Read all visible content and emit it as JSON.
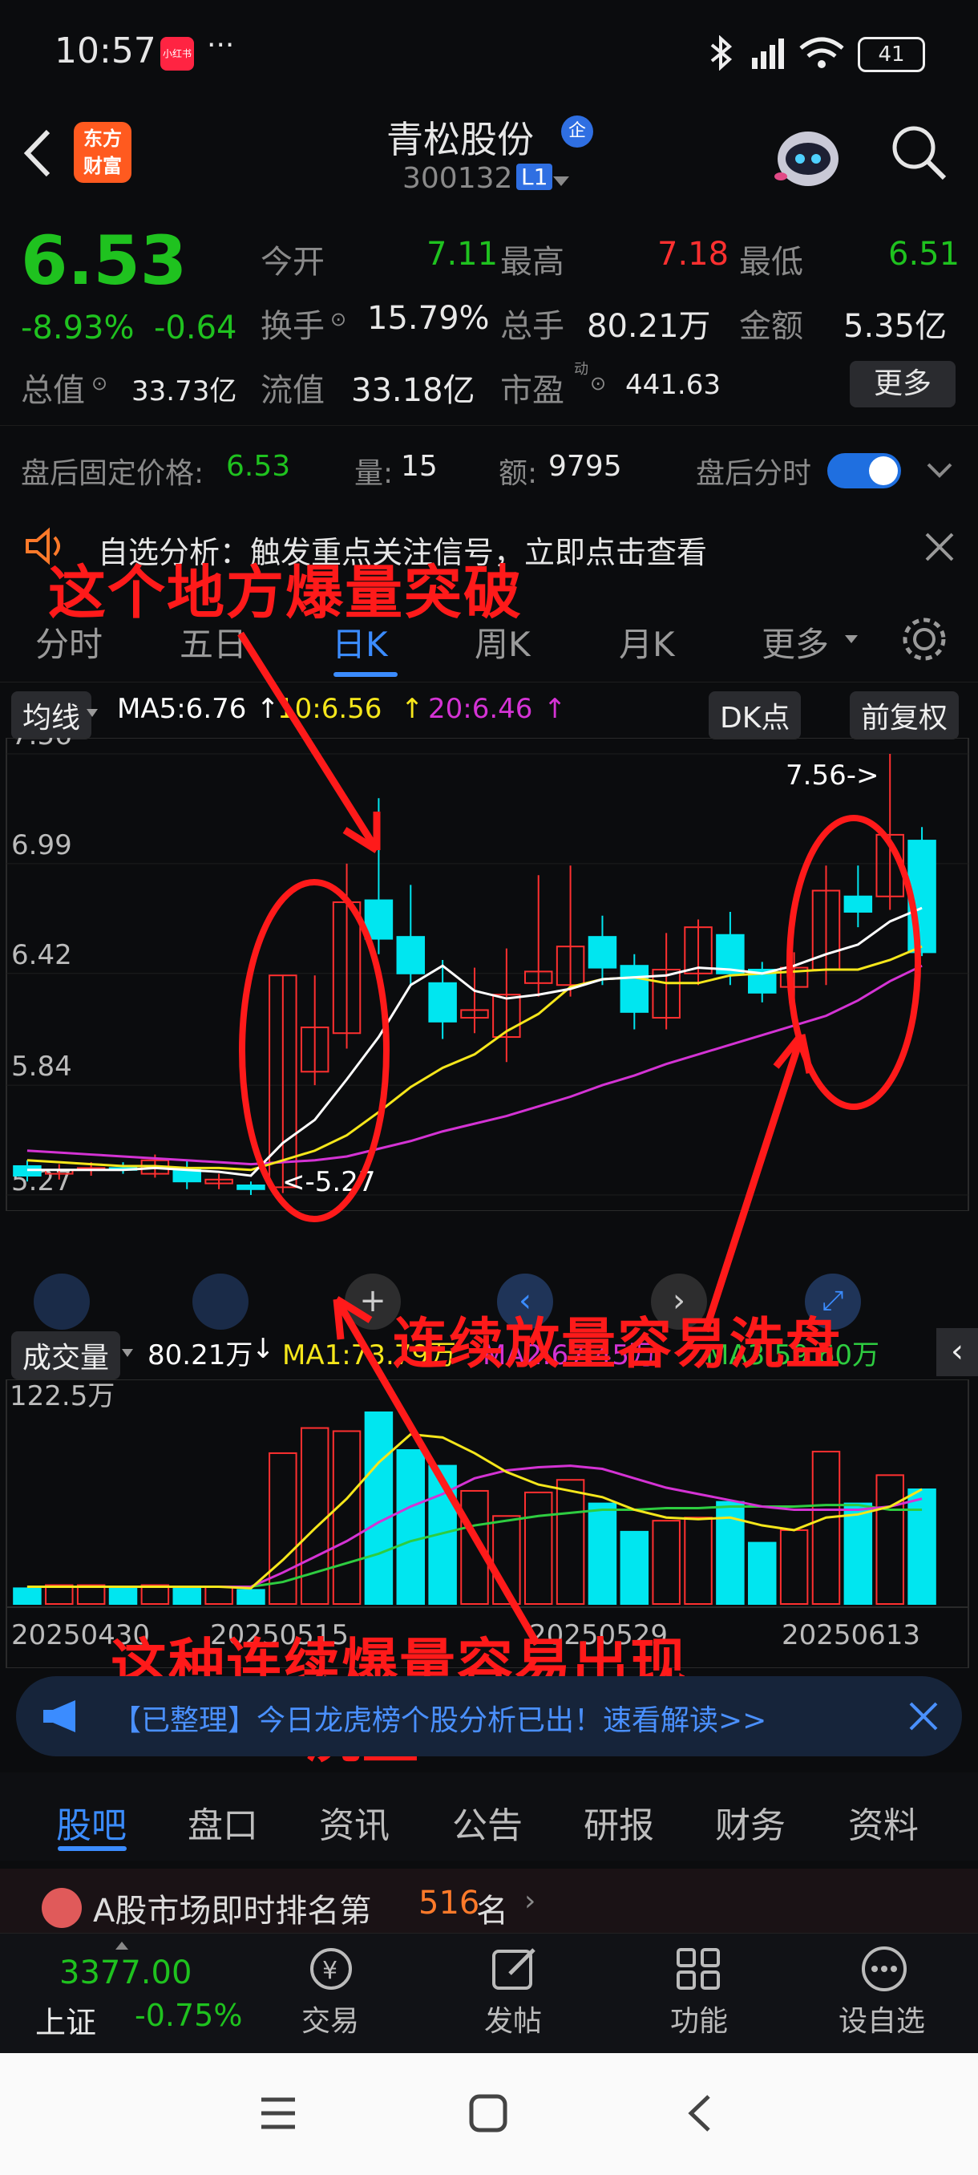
{
  "status": {
    "time": "10:57",
    "app_badge": "小红书",
    "dots": "···",
    "battery": "41"
  },
  "header": {
    "logo_line1": "东方",
    "logo_line2": "财富",
    "title": "青松股份",
    "title_badge": "企",
    "code": "300132",
    "level": "L1"
  },
  "quote": {
    "price": "6.53",
    "change_pct": "-8.93%",
    "change": "-0.64",
    "open_label": "今开",
    "open": "7.11",
    "high_label": "最高",
    "high": "7.18",
    "low_label": "最低",
    "low": "6.51",
    "turnover_label": "换手",
    "turnover": "15.79%",
    "volume_label": "总手",
    "volume": "80.21万",
    "amount_label": "金额",
    "amount": "5.35亿",
    "mktcap_label": "总值",
    "mktcap": "33.73亿",
    "float_label": "流值",
    "float": "33.18亿",
    "pe_label": "市盈",
    "pe_sup": "动",
    "pe": "441.63",
    "more": "更多"
  },
  "after_hours": {
    "price_label": "盘后固定价格:",
    "price": "6.53",
    "qty_label": "量:",
    "qty": "15",
    "amt_label": "额:",
    "amt": "9795",
    "intraday_label": "盘后分时",
    "toggle_on": true
  },
  "notice": {
    "text": "自选分析：触发重点关注信号，立即点击查看"
  },
  "chart_tabs": [
    {
      "label": "分时"
    },
    {
      "label": "五日"
    },
    {
      "label": "日K"
    },
    {
      "label": "周K"
    },
    {
      "label": "月K"
    },
    {
      "label": "更多"
    }
  ],
  "ma_bar": {
    "selector": "均线",
    "ma5": "MA5:6.76",
    "ma10": "10:6.56",
    "ma20": "20:6.46",
    "dk": "DK点",
    "adjust": "前复权"
  },
  "vol_bar": {
    "selector": "成交量",
    "vol": "80.21万",
    "ma1": "MA1:73.79万",
    "ma2": "MA2:67.45万",
    "ma3": "MA3:59.60万"
  },
  "annotations": {
    "a1": "这个地方爆量突破",
    "a2": "连续放量容易洗盘",
    "a3_line1": "这种连续爆量容易出现",
    "a3_line2": "洗盘"
  },
  "chart_data": {
    "type": "candlestick",
    "y_ticks": [
      "7.56",
      "6.99",
      "6.42",
      "5.84",
      "5.27"
    ],
    "ylim": [
      5.27,
      7.56
    ],
    "high_marker": "7.56->",
    "low_marker": "<-5.27",
    "x_ticks": [
      "20250430",
      "20250515",
      "20250529",
      "20250613"
    ],
    "candles": [
      {
        "o": 5.42,
        "c": 5.37,
        "h": 5.45,
        "l": 5.34
      },
      {
        "o": 5.38,
        "c": 5.4,
        "h": 5.43,
        "l": 5.35
      },
      {
        "o": 5.4,
        "c": 5.41,
        "h": 5.44,
        "l": 5.37
      },
      {
        "o": 5.41,
        "c": 5.4,
        "h": 5.44,
        "l": 5.38
      },
      {
        "o": 5.38,
        "c": 5.45,
        "h": 5.48,
        "l": 5.36
      },
      {
        "o": 5.41,
        "c": 5.34,
        "h": 5.45,
        "l": 5.3
      },
      {
        "o": 5.33,
        "c": 5.35,
        "h": 5.38,
        "l": 5.3
      },
      {
        "o": 5.32,
        "c": 5.3,
        "h": 5.34,
        "l": 5.27
      },
      {
        "o": 5.31,
        "c": 6.41,
        "h": 6.41,
        "l": 5.28
      },
      {
        "o": 5.91,
        "c": 6.14,
        "h": 6.41,
        "l": 5.84
      },
      {
        "o": 6.11,
        "c": 6.79,
        "h": 6.99,
        "l": 6.03
      },
      {
        "o": 6.8,
        "c": 6.6,
        "h": 7.33,
        "l": 6.52
      },
      {
        "o": 6.61,
        "c": 6.42,
        "h": 6.88,
        "l": 6.36
      },
      {
        "o": 6.37,
        "c": 6.17,
        "h": 6.49,
        "l": 6.08
      },
      {
        "o": 6.19,
        "c": 6.23,
        "h": 6.45,
        "l": 6.11
      },
      {
        "o": 6.09,
        "c": 6.31,
        "h": 6.55,
        "l": 5.96
      },
      {
        "o": 6.37,
        "c": 6.43,
        "h": 6.93,
        "l": 6.3
      },
      {
        "o": 6.36,
        "c": 6.56,
        "h": 6.98,
        "l": 6.3
      },
      {
        "o": 6.61,
        "c": 6.45,
        "h": 6.72,
        "l": 6.36
      },
      {
        "o": 6.46,
        "c": 6.22,
        "h": 6.52,
        "l": 6.13
      },
      {
        "o": 6.19,
        "c": 6.44,
        "h": 6.63,
        "l": 6.13
      },
      {
        "o": 6.42,
        "c": 6.66,
        "h": 6.7,
        "l": 6.36
      },
      {
        "o": 6.62,
        "c": 6.42,
        "h": 6.74,
        "l": 6.36
      },
      {
        "o": 6.44,
        "c": 6.32,
        "h": 6.48,
        "l": 6.27
      },
      {
        "o": 6.35,
        "c": 6.45,
        "h": 6.53,
        "l": 6.28
      },
      {
        "o": 6.44,
        "c": 6.85,
        "h": 6.98,
        "l": 6.36
      },
      {
        "o": 6.82,
        "c": 6.74,
        "h": 6.98,
        "l": 6.66
      },
      {
        "o": 6.82,
        "c": 7.14,
        "h": 7.56,
        "l": 6.75
      },
      {
        "o": 7.11,
        "c": 6.53,
        "h": 7.18,
        "l": 6.51
      }
    ],
    "ma_lines": {
      "ma5": [
        5.4,
        5.4,
        5.4,
        5.4,
        5.41,
        5.4,
        5.39,
        5.37,
        5.54,
        5.66,
        5.87,
        6.09,
        6.36,
        6.46,
        6.33,
        6.29,
        6.31,
        6.34,
        6.39,
        6.4,
        6.41,
        6.45,
        6.44,
        6.42,
        6.46,
        6.52,
        6.57,
        6.69,
        6.76
      ],
      "ma10": [
        5.45,
        5.44,
        5.43,
        5.42,
        5.42,
        5.41,
        5.41,
        5.4,
        5.45,
        5.5,
        5.58,
        5.7,
        5.83,
        5.93,
        6.0,
        6.12,
        6.21,
        6.35,
        6.39,
        6.4,
        6.37,
        6.37,
        6.41,
        6.42,
        6.43,
        6.44,
        6.44,
        6.49,
        6.56
      ],
      "ma20": [
        5.5,
        5.49,
        5.48,
        5.47,
        5.46,
        5.45,
        5.44,
        5.43,
        5.44,
        5.45,
        5.47,
        5.51,
        5.55,
        5.6,
        5.64,
        5.68,
        5.73,
        5.78,
        5.84,
        5.89,
        5.95,
        6.0,
        6.05,
        6.1,
        6.15,
        6.2,
        6.28,
        6.38,
        6.46
      ]
    },
    "volume": {
      "ymax_label": "122.5万",
      "ymax": 122.5,
      "bars": [
        10,
        12,
        12,
        11,
        12,
        11,
        11,
        9,
        96,
        112,
        110,
        122,
        98,
        88,
        72,
        56,
        71,
        79,
        64,
        46,
        53,
        55,
        65,
        39,
        47,
        97,
        64,
        82,
        73
      ],
      "ma1": [
        11,
        11,
        11,
        11,
        11,
        11,
        11,
        10,
        28,
        48,
        67,
        90,
        108,
        106,
        96,
        84,
        76,
        72,
        68,
        60,
        55,
        54,
        55,
        50,
        47,
        55,
        57,
        62,
        73
      ],
      "ma2": [
        11,
        11,
        11,
        11,
        11,
        11,
        11,
        11,
        20,
        30,
        40,
        52,
        62,
        70,
        80,
        85,
        87,
        88,
        86,
        80,
        74,
        70,
        66,
        62,
        60,
        60,
        60,
        62,
        67
      ],
      "ma3": [
        11,
        11,
        11,
        11,
        11,
        11,
        11,
        11,
        14,
        20,
        26,
        32,
        40,
        45,
        50,
        53,
        56,
        58,
        60,
        60,
        61,
        61,
        62,
        62,
        62,
        63,
        63,
        60,
        60
      ]
    }
  },
  "banner": {
    "text": "【已整理】今日龙虎榜个股分析已出！速看解读>>"
  },
  "bottom_tabs": [
    {
      "label": "股吧"
    },
    {
      "label": "盘口"
    },
    {
      "label": "资讯"
    },
    {
      "label": "公告"
    },
    {
      "label": "研报"
    },
    {
      "label": "财务"
    },
    {
      "label": "资料"
    }
  ],
  "rank": {
    "prefix": "A股市场即时排名第",
    "num": "516",
    "suffix": "名"
  },
  "toolbar": {
    "index_value": "3377.00",
    "index_name": "上证",
    "index_change": "-0.75%",
    "trade": "交易",
    "post": "发帖",
    "func": "功能",
    "watch": "设自选"
  },
  "colors": {
    "up": "#ff3030",
    "down": "#00e6f0",
    "ma5": "#ffffff",
    "ma10": "#f5e61b",
    "ma20": "#d433d4",
    "accent": "#1f6fe0"
  }
}
